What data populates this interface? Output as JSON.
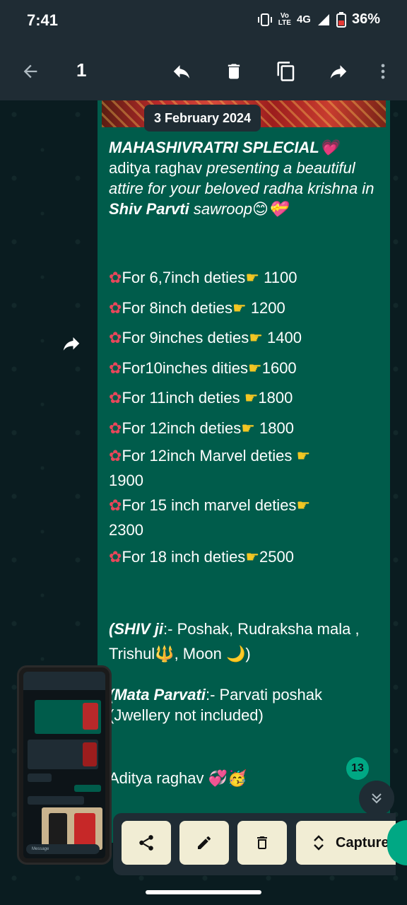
{
  "status_bar": {
    "time": "7:41",
    "network": "4G",
    "lte_top": "Vo",
    "lte_bottom": "LTE",
    "battery": "36%"
  },
  "toolbar": {
    "selected_count": "1",
    "icons": [
      "back-arrow-icon",
      "reply-icon",
      "delete-icon",
      "copy-icon",
      "forward-icon",
      "more-vert-icon"
    ]
  },
  "chat": {
    "date_chip": "3 February 2024",
    "unread_badge": "13",
    "message": {
      "title": "MAHASHIVRATRI SPLECIAL💗",
      "intro_normal": "aditya raghav ",
      "intro_italic": "presenting a beautiful attire for your beloved radha krishna in ",
      "intro_bold": "Shiv Parvti",
      "intro_tail": "  sawroop😊💝",
      "prices": [
        {
          "label": "For 6,7inch deties",
          "price": " 1100",
          "wrap": false
        },
        {
          "label": "For 8inch deties",
          "price": " 1200",
          "wrap": false
        },
        {
          "label": "For 9inches deties",
          "price": " 1400",
          "wrap": false
        },
        {
          "label": "For10inches dities",
          "price": "1600",
          "wrap": false
        },
        {
          "label": "For 11inch deties ",
          "price": "1800",
          "wrap": false
        },
        {
          "label": "For 12inch deties",
          "price": " 1800",
          "wrap": false
        },
        {
          "label": "For 12inch Marvel deties ",
          "price": "1900",
          "wrap": true
        },
        {
          "label": "For 15 inch marvel deties",
          "price": "2300",
          "wrap": true
        },
        {
          "label": "For 18 inch deties",
          "price": "2500",
          "wrap": false
        }
      ],
      "shiv_bold": "(SHIV ji",
      "shiv_text": ":- Poshak, Rudraksha mala , Trishul🔱, Moon 🌙)",
      "parvati_bold": "(Mata Parvati",
      "parvati_text": ":- Parvati poshak (Jwellery not included)",
      "signature": "Aditya raghav 💞🥳"
    }
  },
  "thumbnail": {
    "input_placeholder": "Message"
  },
  "action_bar": {
    "capture_label": "Capture"
  }
}
